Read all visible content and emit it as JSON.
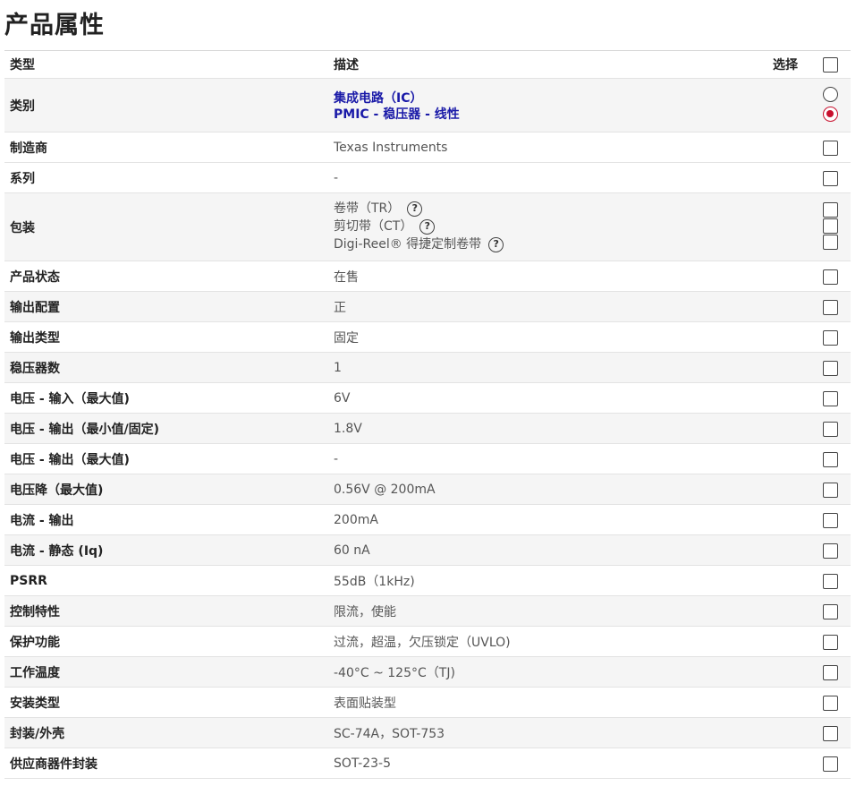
{
  "page_title": "产品属性",
  "header": {
    "type": "类型",
    "desc": "描述",
    "select": "选择"
  },
  "category": {
    "label": "类别",
    "values": [
      "集成电路（IC）",
      "PMIC - 稳压器 - 线性"
    ]
  },
  "packaging": {
    "label": "包装",
    "options": [
      "卷带（TR）",
      "剪切带（CT）",
      "Digi-Reel® 得捷定制卷带"
    ]
  },
  "rows_a": [
    {
      "label": "制造商",
      "value": "Texas Instruments"
    },
    {
      "label": "系列",
      "value": "-"
    }
  ],
  "rows_b": [
    {
      "label": "产品状态",
      "value": "在售"
    },
    {
      "label": "输出配置",
      "value": "正"
    },
    {
      "label": "输出类型",
      "value": "固定"
    },
    {
      "label": "稳压器数",
      "value": "1"
    },
    {
      "label": "电压 - 输入（最大值)",
      "value": "6V"
    },
    {
      "label": "电压 - 输出（最小值/固定)",
      "value": "1.8V"
    },
    {
      "label": "电压 - 输出（最大值)",
      "value": "-"
    },
    {
      "label": "电压降（最大值)",
      "value": "0.56V @ 200mA"
    },
    {
      "label": "电流 - 输出",
      "value": "200mA"
    },
    {
      "label": "电流 - 静态 (Iq)",
      "value": "60 nA"
    },
    {
      "label": "PSRR",
      "value": "55dB（1kHz)"
    },
    {
      "label": "控制特性",
      "value": "限流，使能"
    },
    {
      "label": "保护功能",
      "value": "过流，超温，欠压锁定（UVLO)"
    },
    {
      "label": "工作温度",
      "value": "-40°C ~ 125°C（TJ)"
    },
    {
      "label": "安装类型",
      "value": "表面贴装型"
    },
    {
      "label": "封装/外壳",
      "value": "SC-74A，SOT-753"
    },
    {
      "label": "供应商器件封装",
      "value": "SOT-23-5"
    }
  ],
  "help_icon_glyph": "?"
}
